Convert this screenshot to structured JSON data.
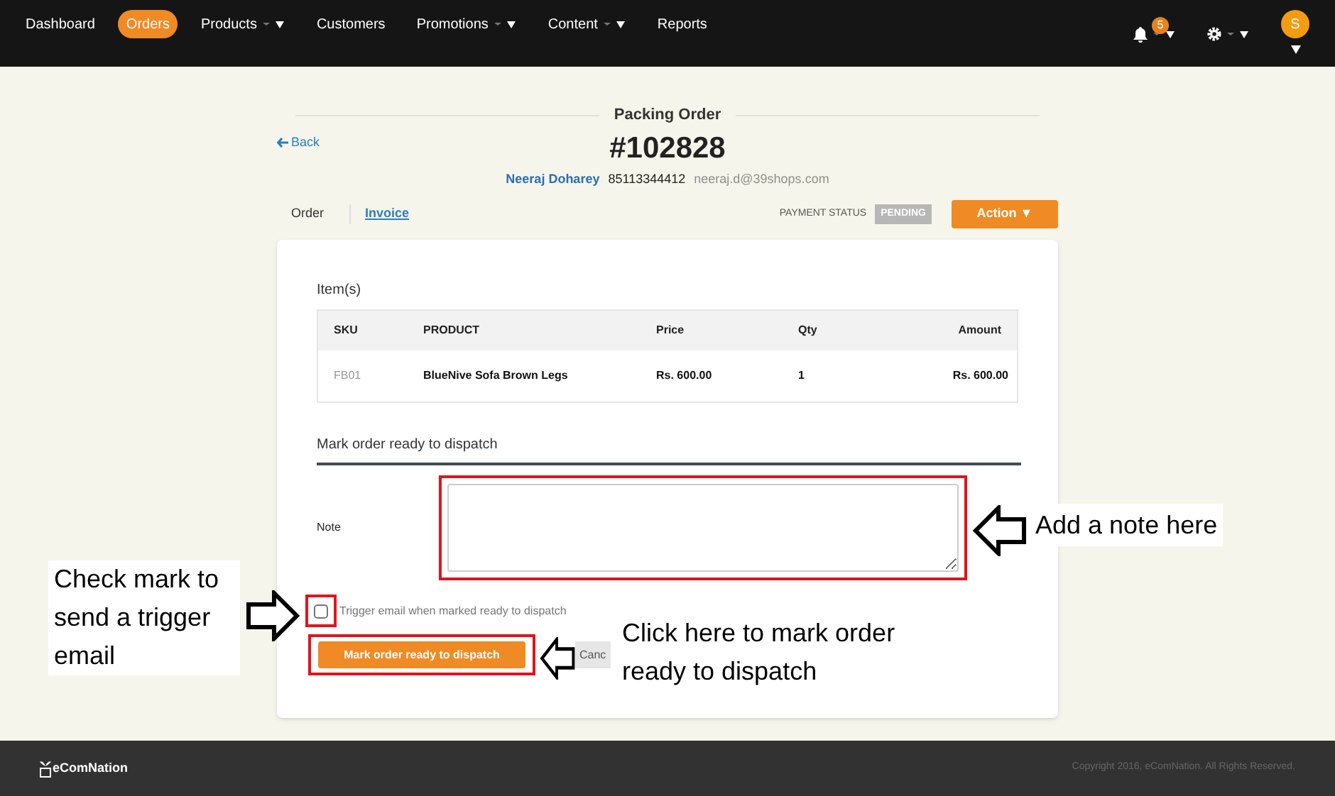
{
  "nav": {
    "items": [
      {
        "label": "Dashboard",
        "selected": false,
        "dropdown": false
      },
      {
        "label": "Orders",
        "selected": true,
        "dropdown": false
      },
      {
        "label": "Products",
        "selected": false,
        "dropdown": true
      },
      {
        "label": "Customers",
        "selected": false,
        "dropdown": false
      },
      {
        "label": "Promotions",
        "selected": false,
        "dropdown": true
      },
      {
        "label": "Content",
        "selected": false,
        "dropdown": true
      },
      {
        "label": "Reports",
        "selected": false,
        "dropdown": false
      }
    ],
    "notification_count": "5",
    "avatar": "S"
  },
  "header": {
    "title": "Packing Order",
    "back": "Back",
    "order_number": "#102828",
    "customer_name": "Neeraj Doharey",
    "phone": "85113344412",
    "email": "neeraj.d@39shops.com"
  },
  "tabs": [
    {
      "label": "Order",
      "selected": true
    },
    {
      "label": "Invoice",
      "selected": false
    }
  ],
  "payment_status": {
    "label": "PAYMENT STATUS",
    "value": "PENDING"
  },
  "action_button": "Action ▼",
  "items": {
    "title": "Item(s)",
    "columns": [
      "SKU",
      "PRODUCT",
      "Price",
      "Qty",
      "Amount"
    ],
    "rows": [
      {
        "sku": "FB01",
        "product": "BlueNive Sofa Brown Legs",
        "price": "Rs. 600.00",
        "qty": "1",
        "amount": "Rs. 600.00"
      }
    ]
  },
  "dispatch": {
    "title": "Mark order ready to dispatch",
    "note_label": "Note",
    "checkbox": {
      "label": "Trigger email when marked ready to dispatch",
      "checked": false
    },
    "primary_button": "Mark order ready to dispatch",
    "secondary_button": "Canc"
  },
  "footer": {
    "brand": "eComNation",
    "copyright": "Copyright 2016, eComNation. All Rights Reserved."
  },
  "annotations": [
    {
      "kind": "checkbox",
      "text": "Check mark to send a trigger email"
    },
    {
      "kind": "note",
      "text": "Add a note here"
    },
    {
      "kind": "button",
      "text": "Click here to mark order ready to dispatch"
    }
  ]
}
